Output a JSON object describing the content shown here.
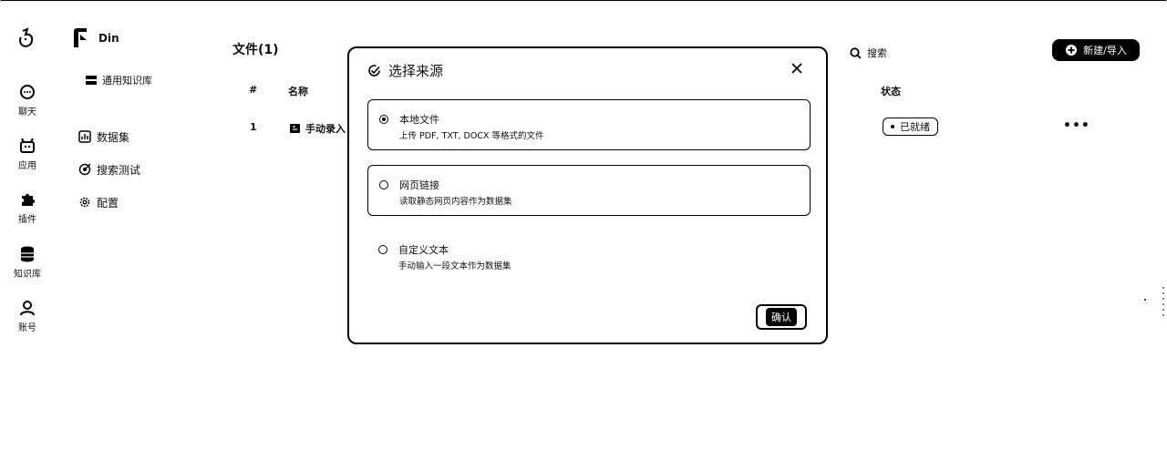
{
  "rail": {
    "items": [
      {
        "label": "聊天",
        "icon": "chat-icon"
      },
      {
        "label": "应用",
        "icon": "robot-icon"
      },
      {
        "label": "插件",
        "icon": "puzzle-icon"
      },
      {
        "label": "知识库",
        "icon": "database-icon"
      },
      {
        "label": "账号",
        "icon": "user-icon"
      }
    ]
  },
  "kb": {
    "name": "Din",
    "type": "通用知识库",
    "nav": [
      {
        "label": "数据集",
        "icon": "dataset-icon"
      },
      {
        "label": "搜索测试",
        "icon": "search-test-icon"
      },
      {
        "label": "配置",
        "icon": "gear-icon"
      }
    ]
  },
  "main": {
    "title": "文件(1)",
    "search_label": "搜索",
    "new_button": "新建/导入",
    "columns": {
      "index": "#",
      "name": "名称",
      "status": "状态"
    },
    "rows": [
      {
        "index": "1",
        "name": "手动录入",
        "status": "已就绪",
        "more": "•••"
      }
    ]
  },
  "modal": {
    "title": "选择来源",
    "options": [
      {
        "title": "本地文件",
        "desc": "上传 PDF, TXT, DOCX 等格式的文件",
        "selected": true
      },
      {
        "title": "网页链接",
        "desc": "读取静态网页内容作为数据集",
        "selected": false
      },
      {
        "title": "自定义文本",
        "desc": "手动输入一段文本作为数据集",
        "selected": false
      }
    ],
    "confirm_label": "确认"
  }
}
